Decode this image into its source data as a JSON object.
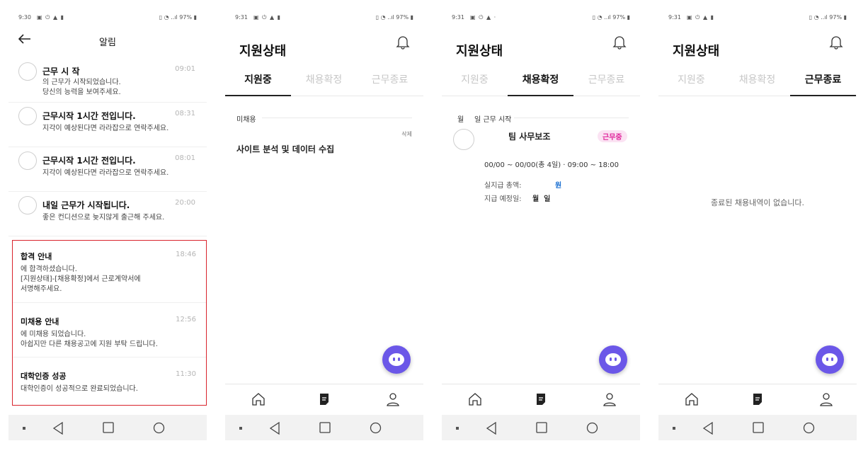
{
  "screen1": {
    "status_time": "9:30",
    "status_right": "97%",
    "title": "알림",
    "notifications": [
      {
        "title": "근무 시 작",
        "time": "09:01",
        "body": "의 근무가 시작되었습니다.\n당신의 능력을 보여주세요."
      },
      {
        "title": "근무시작 1시간 전입니다.",
        "time": "08:31",
        "body": "지각이 예상된다면 라라잡으로 연락주세요."
      },
      {
        "title": "근무시작 1시간 전입니다.",
        "time": "08:01",
        "body": "지각이 예상된다면 라라잡으로 연락주세요."
      },
      {
        "title": "내일 근무가 시작됩니다.",
        "time": "20:00",
        "body": "좋은 컨디션으로 늦지않게 출근해 주세요."
      }
    ],
    "highlighted": [
      {
        "title": "합격 안내",
        "time": "18:46",
        "body": "에 합격하셨습니다.\n[지원상태]-[채용확정]에서 근로계약서에\n서명해주세요."
      },
      {
        "title": "미채용 안내",
        "time": "12:56",
        "body": "에 미채용 되었습니다.\n아쉽지만 다른 채용공고에 지원 부탁 드립니다."
      },
      {
        "title": "대학인증 성공",
        "time": "11:30",
        "body": "대학인증이 성공적으로 완료되었습니다."
      }
    ]
  },
  "screen2": {
    "status_time": "9:31",
    "status_right": "97%",
    "title": "지원상태",
    "tabs": [
      "지원중",
      "채용확정",
      "근무종료"
    ],
    "section_label": "미채용",
    "delete_label": "삭제",
    "job_title": "사이트 분석 및 데이터 수집"
  },
  "screen3": {
    "status_time": "9:31",
    "status_right": "97%",
    "title": "지원상태",
    "tabs": [
      "지원중",
      "채용확정",
      "근무종료"
    ],
    "section_label_month": "월",
    "section_label_day": "일 근무 시작",
    "job_title": "팀 사무보조",
    "badge": "근무중",
    "schedule": "00/00 ~ 00/00(총 4일) · 09:00 ~ 18:00",
    "pay_label": "실지급 총액:",
    "pay_value": "원",
    "paydate_label": "지급 예정일:",
    "paydate_value": "월  일"
  },
  "screen4": {
    "status_time": "9:31",
    "status_right": "97%",
    "title": "지원상태",
    "tabs": [
      "지원중",
      "채용확정",
      "근무종료"
    ],
    "empty_message": "종료된 채용내역이 없습니다."
  },
  "colors": {
    "accent": "#6b57e8",
    "highlight_border": "#d9232c",
    "badge_bg": "#fbe3f3",
    "badge_text": "#e0259b",
    "pay_value": "#1a6fd1"
  },
  "icons": [
    "back-arrow-icon",
    "bell-icon",
    "home-icon",
    "document-icon",
    "profile-icon",
    "chat-icon"
  ]
}
